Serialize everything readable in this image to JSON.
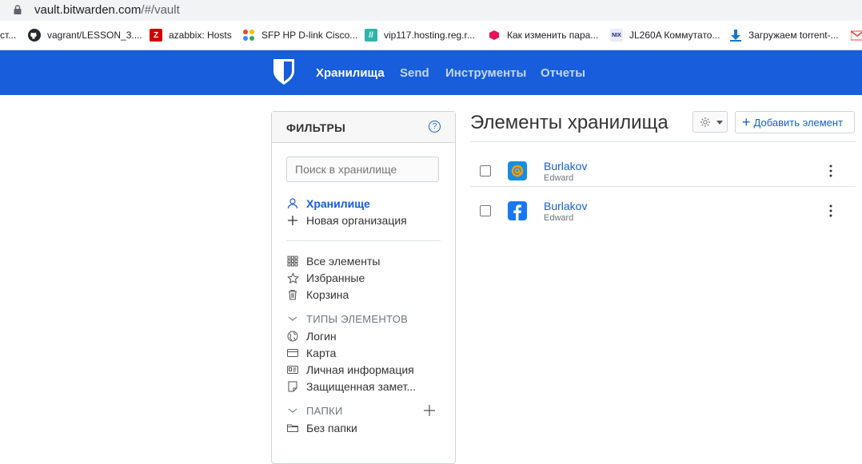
{
  "browser": {
    "url_host": "vault.bitwarden.com",
    "url_path": "/#/vault",
    "bookmarks": [
      {
        "label": "ст...",
        "icon": "partial-icon",
        "color": "#ffffff"
      },
      {
        "label": "vagrant/LESSON_3....",
        "icon": "github-icon",
        "color": "#24292e"
      },
      {
        "label": "azabbix: Hosts",
        "icon": "zabbix-icon",
        "color": "#d40000"
      },
      {
        "label": "SFP HP D-link Cisco...",
        "icon": "colorful-dots-icon",
        "color": "#ea4335"
      },
      {
        "label": "vip117.hosting.reg.r...",
        "icon": "reg-icon",
        "color": "#2fb5a8"
      },
      {
        "label": "Как изменить пара...",
        "icon": "cube-icon",
        "color": "#e8125c"
      },
      {
        "label": "JL260A Коммутато...",
        "icon": "nix-icon",
        "color": "#1a237e"
      },
      {
        "label": "Загружаем torrent-...",
        "icon": "download-icon",
        "color": "#1976d2"
      },
      {
        "label": "",
        "icon": "gmail-icon",
        "color": "#ea4335"
      }
    ]
  },
  "nav": {
    "brand_color": "#175ddc",
    "links": [
      {
        "label": "Хранилища",
        "active": true
      },
      {
        "label": "Send",
        "active": false
      },
      {
        "label": "Инструменты",
        "active": false
      },
      {
        "label": "Отчеты",
        "active": false
      }
    ]
  },
  "filters": {
    "title": "ФИЛЬТРЫ",
    "search_placeholder": "Поиск в хранилище",
    "vault_label": "Хранилище",
    "new_org_label": "Новая организация",
    "all_items": "Все элементы",
    "favorites": "Избранные",
    "trash": "Корзина",
    "types_header": "ТИПЫ ЭЛЕМЕНТОВ",
    "types": [
      "Логин",
      "Карта",
      "Личная информация",
      "Защищенная замет..."
    ],
    "folders_header": "ПАПКИ",
    "no_folder": "Без папки"
  },
  "vault": {
    "title": "Элементы хранилища",
    "add_label": "Добавить элемент",
    "items": [
      {
        "name": "Burlakov",
        "username": "Edward",
        "icon": "mail-ru-icon"
      },
      {
        "name": "Burlakov",
        "username": "Edward",
        "icon": "facebook-icon"
      }
    ]
  }
}
